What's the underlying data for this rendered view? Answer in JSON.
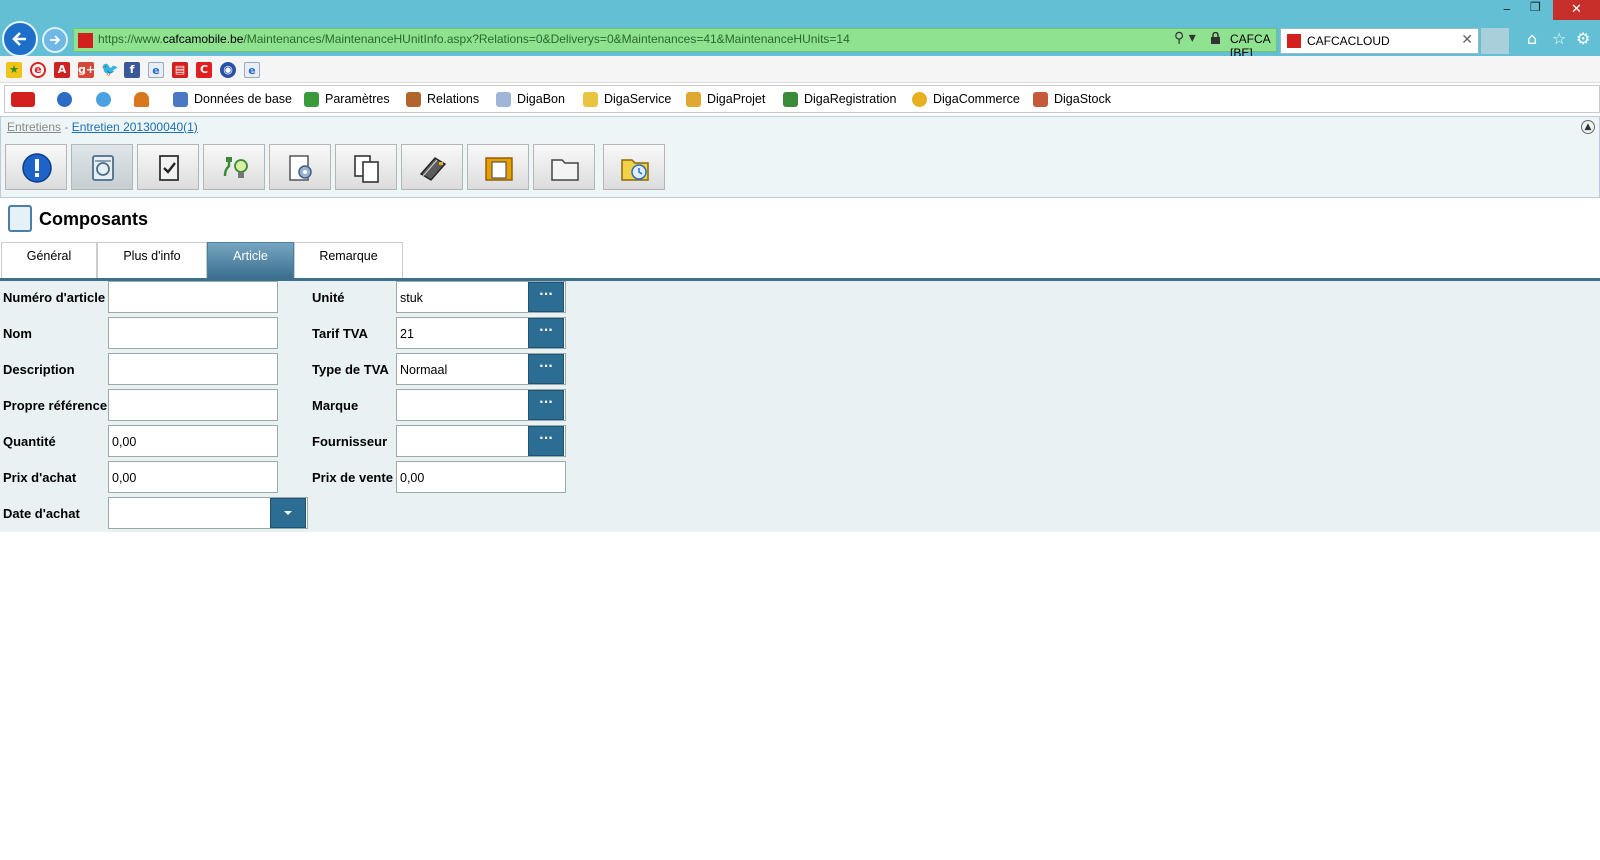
{
  "browser": {
    "url_prefix": "https://www.",
    "url_domain": "cafcamobile.be",
    "url_path": "/Maintenances/MaintenanceHUnitInfo.aspx?Relations=0&Deliverys=0&Maintenances=41&MaintenanceHUnits=14",
    "site_label": "CAFCA [BE]",
    "tab_title": "CAFCACLOUD",
    "icons": [
      "back-arrow-icon",
      "forward-arrow-icon",
      "search-icon",
      "lock-icon",
      "refresh-icon",
      "home-icon",
      "star-icon",
      "gear-icon"
    ]
  },
  "favorites": [
    "star-plus-icon",
    "e-icon",
    "pdf-icon",
    "google-plus-icon",
    "twitter-icon",
    "facebook-icon",
    "ie-icon",
    "cafca-icon",
    "c-icon",
    "globe-icon",
    "ie-page-icon"
  ],
  "menu": {
    "items": [
      {
        "label": ""
      },
      {
        "label": ""
      },
      {
        "label": ""
      },
      {
        "label": ""
      },
      {
        "label": "Données de base"
      },
      {
        "label": "Paramètres"
      },
      {
        "label": "Relations"
      },
      {
        "label": "DigaBon"
      },
      {
        "label": "DigaService"
      },
      {
        "label": "DigaProjet"
      },
      {
        "label": "DigaRegistration"
      },
      {
        "label": "DigaCommerce"
      },
      {
        "label": "DigaStock"
      }
    ]
  },
  "breadcrumb": {
    "first": "Entretiens",
    "separator": " - ",
    "second": "Entretien 201300040(1)"
  },
  "toolbar": {
    "buttons": [
      "info-icon",
      "machine-icon",
      "checklist-icon",
      "plug-bulb-icon",
      "document-gear-icon",
      "documents-icon",
      "book-icon",
      "folder-doc-icon",
      "folder-icon",
      "folder-clock-icon"
    ],
    "active_index": 1
  },
  "section": {
    "title": "Composants"
  },
  "tabs": {
    "items": [
      {
        "label": "Général"
      },
      {
        "label": "Plus d'info"
      },
      {
        "label": "Article"
      },
      {
        "label": "Remarque"
      }
    ],
    "active_index": 2
  },
  "form": {
    "left": [
      {
        "label": "Numéro d'article",
        "value": ""
      },
      {
        "label": "Nom",
        "value": ""
      },
      {
        "label": "Description",
        "value": ""
      },
      {
        "label": "Propre référence",
        "value": ""
      },
      {
        "label": "Quantité",
        "value": "0,00"
      },
      {
        "label": "Prix d'achat",
        "value": "0,00"
      },
      {
        "label": "Date d'achat",
        "value": ""
      }
    ],
    "right": [
      {
        "label": "Unité",
        "value": "stuk"
      },
      {
        "label": "Tarif TVA",
        "value": "21"
      },
      {
        "label": "Type de TVA",
        "value": "Normaal"
      },
      {
        "label": "Marque",
        "value": ""
      },
      {
        "label": "Fournisseur",
        "value": ""
      },
      {
        "label": "Prix de vente",
        "value": "0,00"
      }
    ],
    "picker_label": "···"
  },
  "colors": {
    "accent": "#2c6d94",
    "address_bar": "#8fe28f",
    "titlebar": "#62bfd4",
    "form_bg": "#eaf1f3"
  }
}
